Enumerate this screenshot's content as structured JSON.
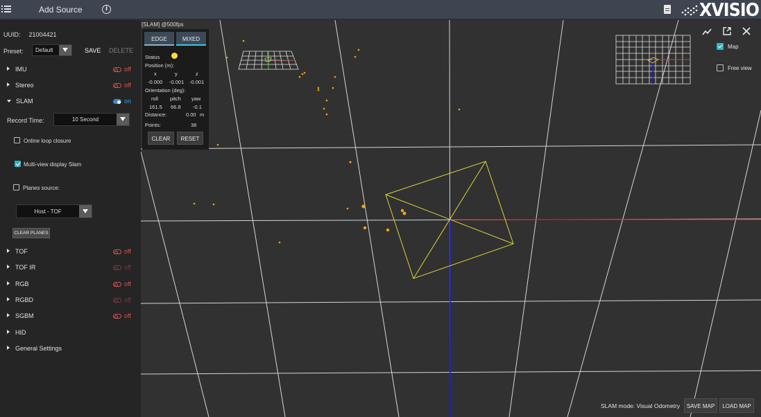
{
  "topbar": {
    "title": "Add Source",
    "logo_text": "XVISIO",
    "icons": [
      "hamburger-menu-icon",
      "info-icon",
      "document-icon"
    ]
  },
  "sidebar": {
    "uuid_label": "UUID:",
    "uuid_value": "21004421",
    "preset_label": "Preset:",
    "preset_value": "Default",
    "save_label": "SAVE",
    "delete_label": "DELETE",
    "sections": [
      {
        "label": "IMU",
        "state": "off"
      },
      {
        "label": "Stereo",
        "state": "off"
      },
      {
        "label": "SLAM",
        "state": "on"
      }
    ],
    "slam": {
      "record_time_label": "Record Time:",
      "record_time_value": "10 Second",
      "online_loop_closure_label": "Online loop closure",
      "online_loop_closure_checked": false,
      "multi_view_label": "Multi-view display Slam",
      "multi_view_checked": true,
      "planes_source_label": "Planes source:",
      "planes_source_checked": false,
      "planes_source_value": "Host - TOF",
      "clear_planes_label": "CLEAR PLANES"
    },
    "lower_sections": [
      {
        "label": "TOF",
        "state": "off"
      },
      {
        "label": "TOF IR",
        "state": "off"
      },
      {
        "label": "RGB",
        "state": "off"
      },
      {
        "label": "RGBD",
        "state": "off"
      },
      {
        "label": "SGBM",
        "state": "off"
      },
      {
        "label": "HID",
        "state": ""
      },
      {
        "label": "General Settings",
        "state": ""
      }
    ]
  },
  "viewport": {
    "title": "[SLAM] @500fps",
    "mode_edge": "EDGE",
    "mode_mixed": "MIXED",
    "status_label": "Status",
    "status_color": "#f5df3c",
    "position_label": "Position (m):",
    "pos_x_label": "x",
    "pos_y_label": "y",
    "pos_z_label": "z",
    "pos_x": "-0.000",
    "pos_y": "-0.001",
    "pos_z": "-0.001",
    "orientation_label": "Orientation (deg):",
    "roll_label": "roll",
    "pitch_label": "pitch",
    "yaw_label": "yaw",
    "roll": "161.5",
    "pitch": "66.8",
    "yaw": "-0.1",
    "distance_label": "Distance:",
    "distance_value": "0.00",
    "distance_unit": "m",
    "points_label": "Points:",
    "points_value": "38",
    "clear_label": "CLEAR",
    "reset_label": "RESET",
    "map_label": "Map",
    "map_checked": true,
    "free_view_label": "Free view",
    "free_view_checked": false,
    "slam_mode_text": "SLAM mode: Visual Odometry",
    "save_map_label": "SAVE MAP",
    "load_map_label": "LOAD MAP",
    "tool_icons": [
      "chart-line-icon",
      "external-link-icon",
      "close-icon"
    ],
    "colors": {
      "x_axis": "#d42020",
      "z_axis": "#1a1acc",
      "frame": "#d9d43a",
      "points": "#f5a614",
      "checkbox": "#2bb5c8",
      "toggle_on": "#3d85d8",
      "toggle_off": "#d9544f"
    }
  }
}
